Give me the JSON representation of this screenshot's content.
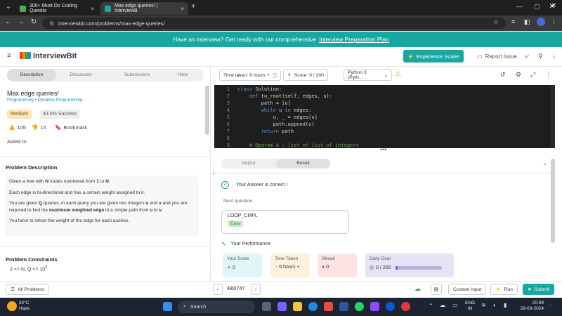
{
  "browser": {
    "tabs": [
      {
        "title": "300+ Must Do Coding Questio"
      },
      {
        "title": "Max edge queries! | InterviewB"
      }
    ],
    "new_tab": "+",
    "url": "interviewbit.com/problems/max-edge-queries/"
  },
  "banner": {
    "text": "Have an interview? Get ready with our comprehensive",
    "link": "Interview Preparation Plan"
  },
  "header": {
    "logo": "InterviewBit",
    "experience_button": "Experience Scaler",
    "report_issue": "Report Issue"
  },
  "left_tabs": [
    "Description",
    "Discussion",
    "Submissions",
    "Hints"
  ],
  "problem": {
    "title": "Max edge queries!",
    "breadcrumb": "Programming • Dynamic Programming",
    "difficulty": "Medium",
    "success": "43.5% Success",
    "likes": "105",
    "dislikes": "15",
    "bookmark": "Bookmark",
    "asked_in": "Asked In:",
    "description_title": "Problem Description",
    "constraints_title": "Problem Constraints",
    "constraint_1": "2 <= N, Q <= 10",
    "constraint_1_sup": "5"
  },
  "toolbar": {
    "time_taken": "Time taken: 6 hours +",
    "score": "Score: 0 / 200",
    "language": "Python 3 (Pyth..."
  },
  "code_lines": [
    {
      "n": "1",
      "t": "class Solution:"
    },
    {
      "n": "2",
      "t": "    def to_root(self, edges, u):"
    },
    {
      "n": "3",
      "t": "        path = [u]"
    },
    {
      "n": "4",
      "t": "        while u in edges:"
    },
    {
      "n": "5",
      "t": "            u, _ = edges[u]"
    },
    {
      "n": "6",
      "t": "            path.append(u)"
    },
    {
      "n": "7",
      "t": "        return path"
    },
    {
      "n": "8",
      "t": ""
    },
    {
      "n": "9",
      "t": "    # @param A : list of list of integers"
    }
  ],
  "result": {
    "tabs": [
      "Output",
      "Result"
    ],
    "message": "Your Answer is correct !",
    "next_label": "Next question",
    "next_name": "LOOP_CMPL",
    "next_difficulty": "Easy",
    "performance_title": "Your Performance",
    "cards": [
      {
        "label": "Your Score",
        "value": "0"
      },
      {
        "label": "Time Taken",
        "value": "6 hours +"
      },
      {
        "label": "Streak",
        "value": "0"
      },
      {
        "label": "Daily Goal",
        "value": "0 / 200"
      }
    ],
    "daily_goal_progress": 0.05
  },
  "bottom": {
    "all_problems": "All Problems",
    "pager": "480/747",
    "custom_input": "Custom Input",
    "run": "Run",
    "submit": "Submit"
  },
  "taskbar": {
    "weather_temp": "32°C",
    "weather_desc": "Haze",
    "search": "Search",
    "lang_top": "ENG",
    "lang_bottom": "IN",
    "time": "20:39",
    "date": "28-03-2024"
  },
  "colors": {
    "brand_teal": "#19a7a2",
    "success_green": "#2e9d5b",
    "medium_badge": "#fbe3b5"
  }
}
